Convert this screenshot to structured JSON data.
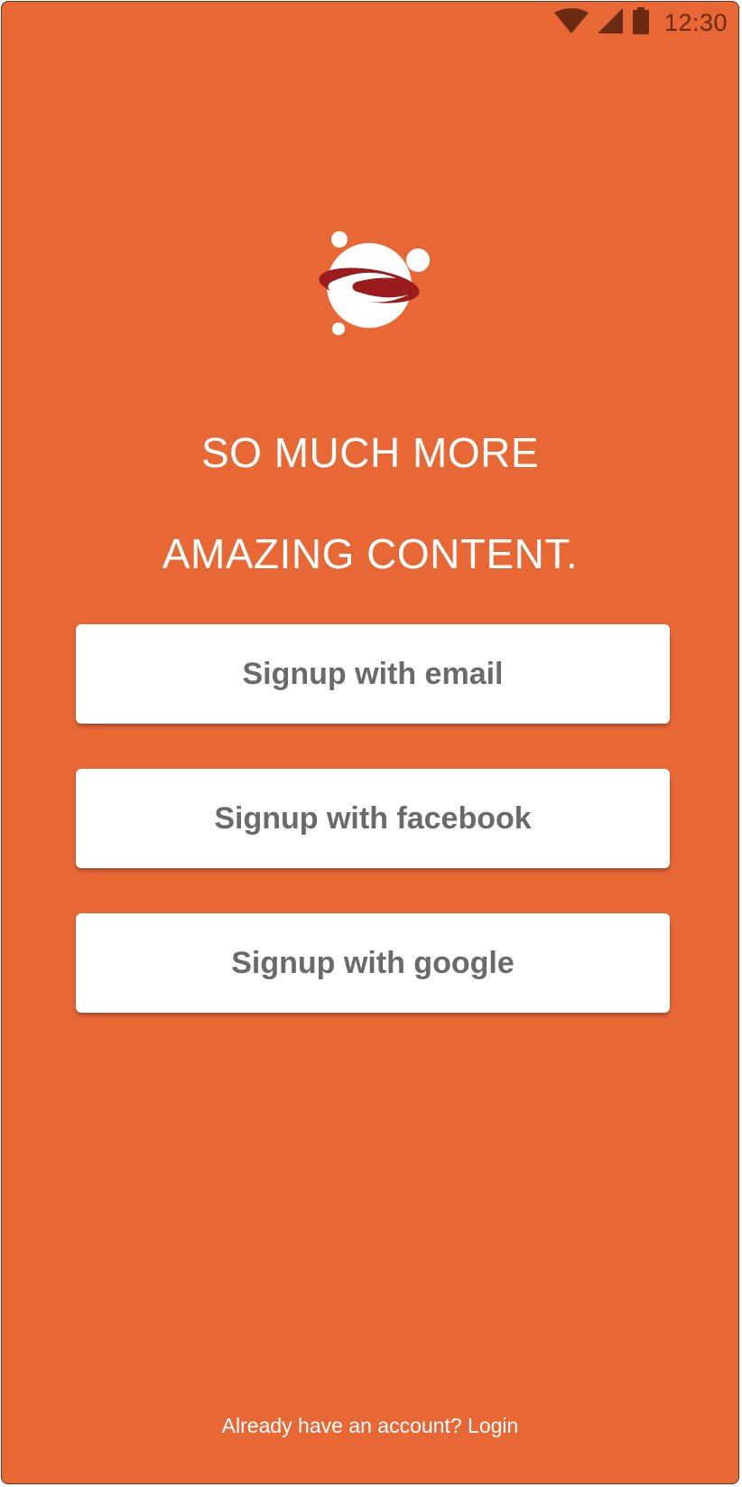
{
  "colors": {
    "background": "#E76835",
    "status_icons": "#6b2a12",
    "headline_text": "#FFFFFF",
    "button_bg": "#FFFFFF",
    "button_text": "#6a6a6a",
    "footer_text": "#FFFFFF",
    "logo_ring": "#9b1c1c"
  },
  "status_bar": {
    "time": "12:30",
    "icons": [
      "wifi-icon",
      "cellular-signal-icon",
      "battery-icon"
    ]
  },
  "logo": {
    "icon": "app-logo-icon"
  },
  "headline": {
    "line1": "SO MUCH MORE",
    "line2": "AMAZING CONTENT."
  },
  "buttons": {
    "email": "Signup with email",
    "facebook": "Signup with facebook",
    "google": "Signup with google"
  },
  "footer": {
    "prompt": "Already have an account? ",
    "login": "Login"
  }
}
